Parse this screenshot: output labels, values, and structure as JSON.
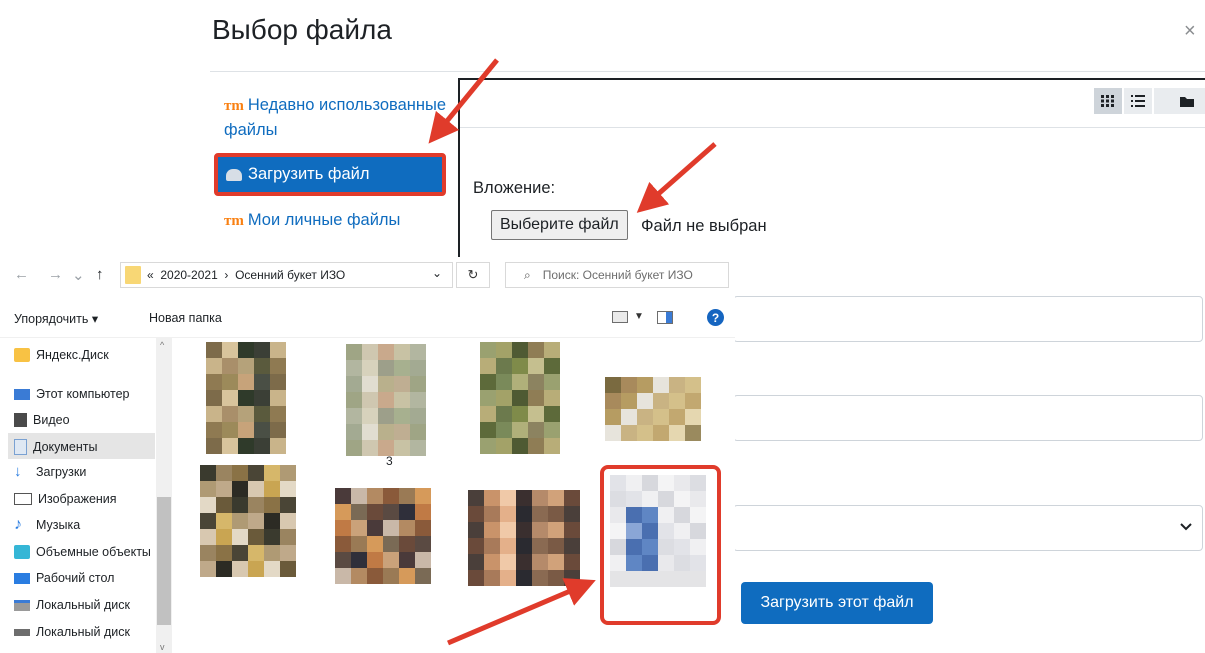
{
  "dialog": {
    "title": "Выбор файла",
    "close": "×",
    "repositories": [
      {
        "label": "Недавно использованные файлы",
        "icon": "moodle-logo-icon"
      },
      {
        "label": "Загрузить файл",
        "icon": "upload-icon",
        "active": true
      },
      {
        "label": "Мои личные файлы",
        "icon": "moodle-logo-icon"
      }
    ],
    "view_buttons": [
      "grid-view-icon",
      "list-view-icon",
      "folder-view-icon"
    ],
    "attachment_label": "Вложение:",
    "choose_file_button": "Выберите файл",
    "no_file_text": "Файл не выбран",
    "upload_button": "Загрузить этот файл",
    "logo_glyph": "m",
    "close_glyph": "×"
  },
  "explorer": {
    "nav": {
      "back": "←",
      "forward": "→",
      "up": "↑"
    },
    "breadcrumb": [
      "«",
      "2020-2021",
      "›",
      "Осенний букет ИЗО"
    ],
    "address_dropdown": "⌄",
    "refresh": "↻",
    "search_placeholder": "Поиск: Осенний букет ИЗО",
    "search_glyph": "⌕",
    "organize_label": "Упорядочить ▾",
    "new_folder_label": "Новая папка",
    "help_glyph": "?",
    "tree": [
      {
        "label": "Яндекс.Диск",
        "icon": "yandex-disk-icon"
      },
      {
        "label": "Этот компьютер",
        "icon": "computer-icon"
      },
      {
        "label": "Видео",
        "icon": "video-icon"
      },
      {
        "label": "Документы",
        "icon": "documents-icon",
        "selected": true
      },
      {
        "label": "Загрузки",
        "icon": "downloads-icon"
      },
      {
        "label": "Изображения",
        "icon": "pictures-icon"
      },
      {
        "label": "Музыка",
        "icon": "music-icon"
      },
      {
        "label": "Объемные объекты",
        "icon": "3d-objects-icon"
      },
      {
        "label": "Рабочий стол",
        "icon": "desktop-icon"
      },
      {
        "label": "Локальный диск",
        "icon": "local-disk-icon"
      },
      {
        "label": "Локальный диск",
        "icon": "local-disk-icon"
      }
    ],
    "thumb_caption": "3"
  },
  "colors": {
    "accent": "#0f6cbf",
    "highlight": "#e03b2b",
    "moodle_orange": "#f98012"
  }
}
